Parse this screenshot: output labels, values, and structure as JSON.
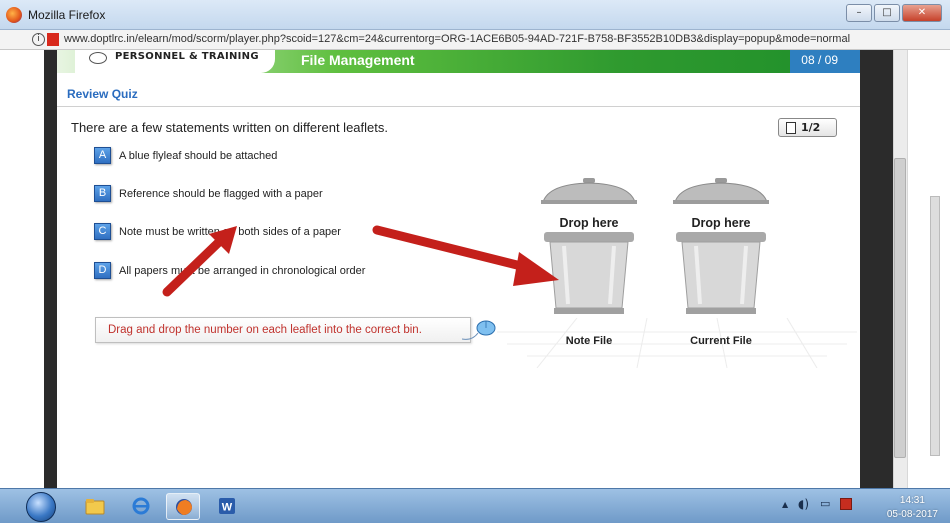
{
  "window": {
    "title": "Mozilla Firefox",
    "controls": {
      "minimize": "–",
      "maximize": "□",
      "close": "✕"
    }
  },
  "urlbar": {
    "url": "www.doptlrc.in/elearn/mod/scorm/player.php?scoid=127&cm=24&currentorg=ORG-1ACE6B05-94AD-721F-B758-BF3552B10DB3&display=popup&mode=normal",
    "info": "i"
  },
  "course": {
    "org_name": "PERSONNEL & TRAINING",
    "module": "File Management",
    "page": "08 / 09",
    "section_title": "Review Quiz",
    "question": "There are a few statements written on different leaflets.",
    "pager": "1/2",
    "options": [
      {
        "key": "A",
        "text": "A blue flyleaf should be attached"
      },
      {
        "key": "B",
        "text": "Reference should be flagged with a paper"
      },
      {
        "key": "C",
        "text": "Note must be written on both sides of a paper"
      },
      {
        "key": "D",
        "text": "All papers must be arranged in chronological order"
      }
    ],
    "instruction": "Drag and drop the number on each leaflet into the correct bin.",
    "bins": [
      {
        "drop_label": "Drop here",
        "name": "Note File"
      },
      {
        "drop_label": "Drop here",
        "name": "Current File"
      }
    ]
  },
  "taskbar": {
    "clock_time": "14:31",
    "clock_date": "05-08-2017"
  },
  "colors": {
    "banner_green": "#2f9a2f",
    "quiz_blue": "#2a6cbf",
    "instruction_red": "#c0322d",
    "arrow_red": "#c4201b"
  }
}
